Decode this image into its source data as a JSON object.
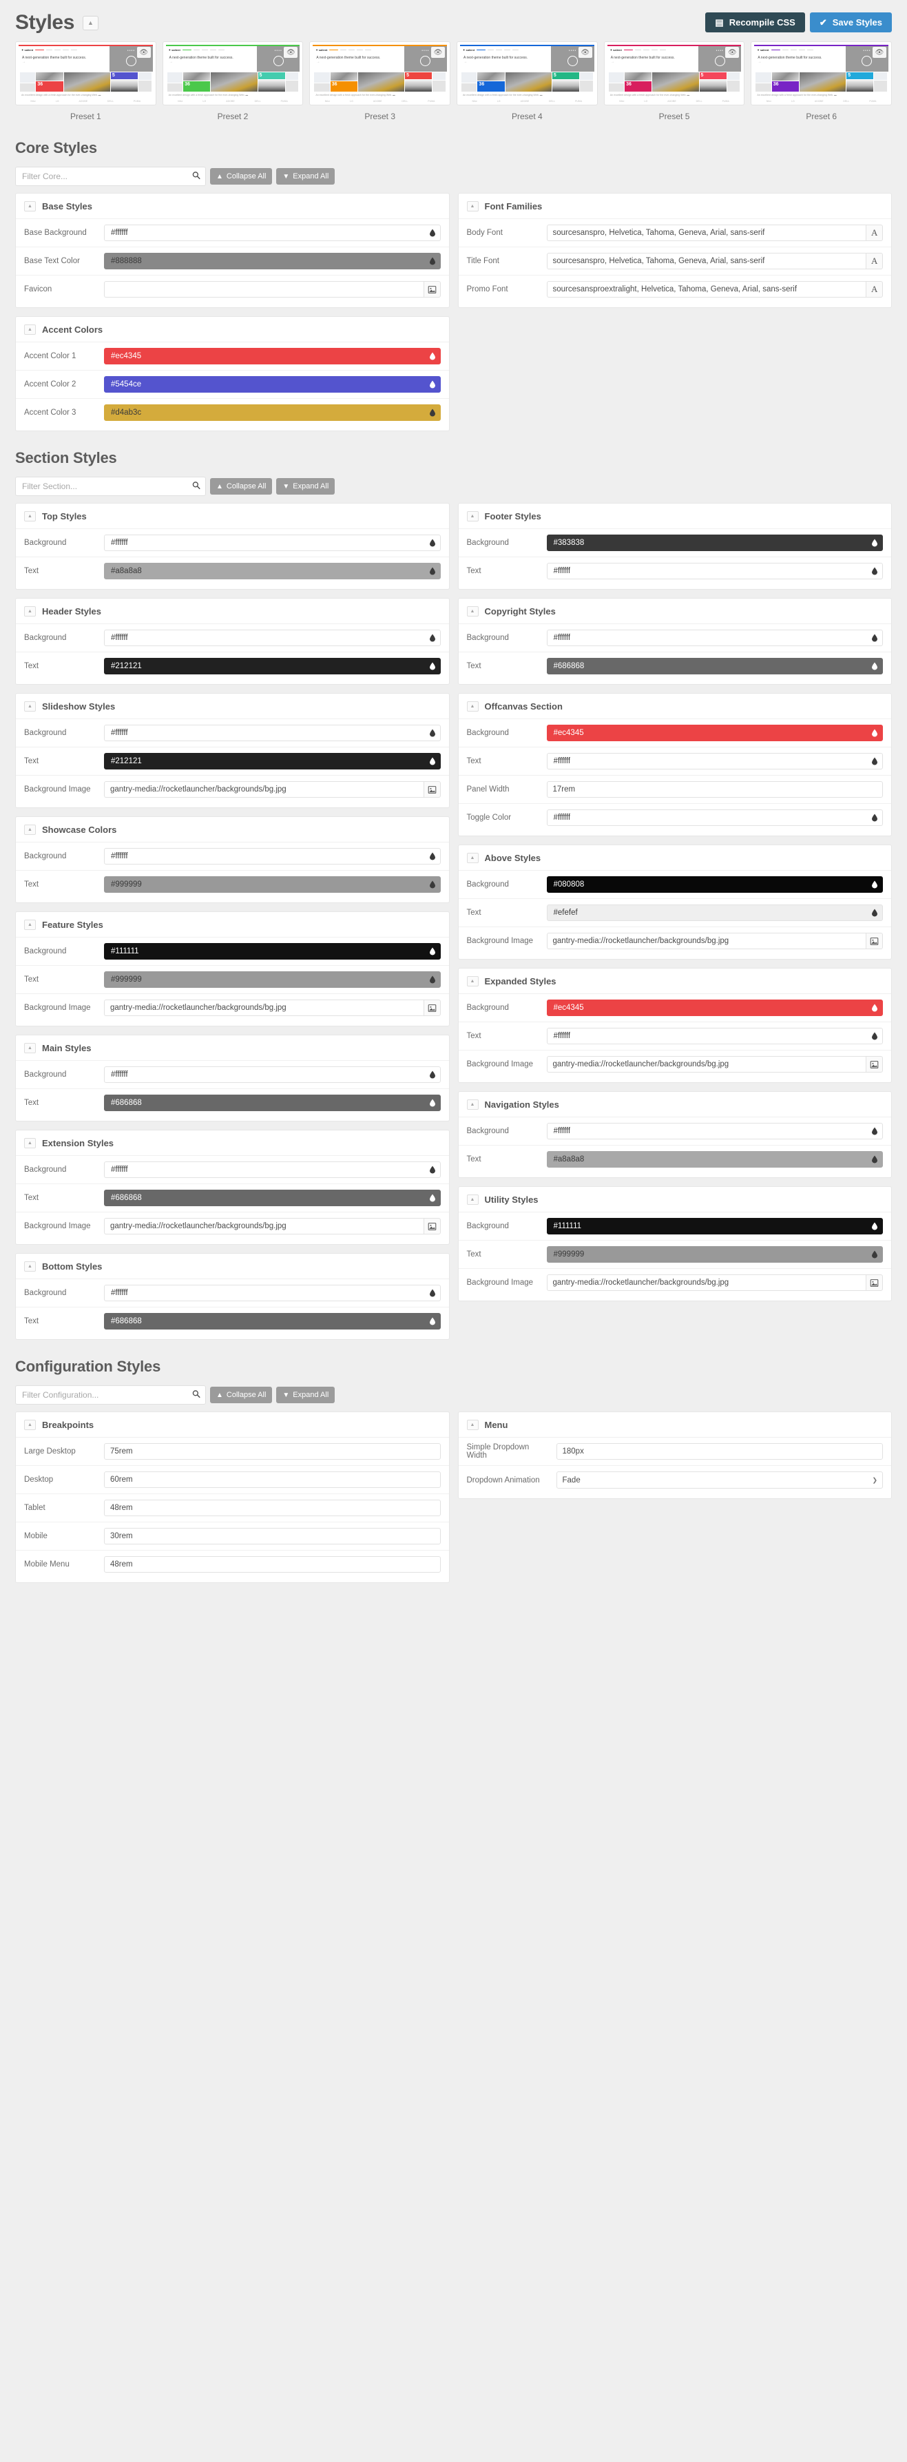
{
  "header": {
    "title": "Styles",
    "collapse_caret": "▲",
    "recompile_label": "Recompile CSS",
    "save_label": "Save Styles"
  },
  "presets": {
    "logo_text": "salient",
    "hero_text": "A next-generation theme built for success.",
    "caption": "An excellent design with a fresh approach for the ever-changing Web.",
    "tile_number_big": "36",
    "tile_number_small": "5",
    "tile_big_sub": "PROJECTS",
    "tile_small_sub": "TEAM MEMBERS",
    "brands": [
      "Nike",
      "LG",
      "ADOBE",
      "DELL",
      "PUMA"
    ],
    "items": [
      {
        "label": "Preset 1",
        "accent1": "#ec4345",
        "accent2": "#5454ce",
        "accent3": "#060606",
        "topline": "#ec4345"
      },
      {
        "label": "Preset 2",
        "accent1": "#4bc84b",
        "accent2": "#44ccae",
        "accent3": "#060606",
        "topline": "#4bc84b"
      },
      {
        "label": "Preset 3",
        "accent1": "#f59000",
        "accent2": "#ee4540",
        "accent3": "#060606",
        "topline": "#f59000"
      },
      {
        "label": "Preset 4",
        "accent1": "#1567d8",
        "accent2": "#24b785",
        "accent3": "#060606",
        "topline": "#1567d8"
      },
      {
        "label": "Preset 5",
        "accent1": "#d81f5e",
        "accent2": "#f4465a",
        "accent3": "#060606",
        "topline": "#d81f5e"
      },
      {
        "label": "Preset 6",
        "accent1": "#7824c5",
        "accent2": "#21a9db",
        "accent3": "#060606",
        "topline": "#7824c5"
      }
    ]
  },
  "core": {
    "title": "Core Styles",
    "filter_placeholder": "Filter Core...",
    "collapse_all": "Collapse All",
    "expand_all": "Expand All",
    "panels_left": [
      {
        "name": "Base Styles",
        "fields": [
          {
            "label": "Base Background",
            "type": "color",
            "value": "#ffffff",
            "bg": "#ffffff",
            "fg": "#3a3a3a"
          },
          {
            "label": "Base Text Color",
            "type": "color",
            "value": "#888888",
            "bg": "#888888",
            "fg": "#3a3a3a"
          },
          {
            "label": "Favicon",
            "type": "file",
            "value": "",
            "placeholder": ""
          }
        ]
      },
      {
        "name": "Accent Colors",
        "fields": [
          {
            "label": "Accent Color 1",
            "type": "color",
            "value": "#ec4345",
            "bg": "#ec4345",
            "fg": "#ffffff"
          },
          {
            "label": "Accent Color 2",
            "type": "color",
            "value": "#5454ce",
            "bg": "#5454ce",
            "fg": "#ffffff"
          },
          {
            "label": "Accent Color 3",
            "type": "color",
            "value": "#d4ab3c",
            "bg": "#d4ab3c",
            "fg": "#3a3a3a"
          }
        ]
      }
    ],
    "panels_right": [
      {
        "name": "Font Families",
        "fields": [
          {
            "label": "Body Font",
            "type": "font",
            "value": "sourcesanspro, Helvetica, Tahoma, Geneva, Arial, sans-serif"
          },
          {
            "label": "Title Font",
            "type": "font",
            "value": "sourcesanspro, Helvetica, Tahoma, Geneva, Arial, sans-serif"
          },
          {
            "label": "Promo Font",
            "type": "font",
            "value": "sourcesansproextralight, Helvetica, Tahoma, Geneva, Arial, sans-serif"
          }
        ]
      }
    ]
  },
  "section": {
    "title": "Section Styles",
    "filter_placeholder": "Filter Section...",
    "collapse_all": "Collapse All",
    "expand_all": "Expand All",
    "panels_left": [
      {
        "name": "Top Styles",
        "fields": [
          {
            "label": "Background",
            "type": "color",
            "value": "#ffffff",
            "bg": "#ffffff",
            "fg": "#3a3a3a"
          },
          {
            "label": "Text",
            "type": "color",
            "value": "#a8a8a8",
            "bg": "#a8a8a8",
            "fg": "#3a3a3a"
          }
        ]
      },
      {
        "name": "Header Styles",
        "fields": [
          {
            "label": "Background",
            "type": "color",
            "value": "#ffffff",
            "bg": "#ffffff",
            "fg": "#3a3a3a"
          },
          {
            "label": "Text",
            "type": "color",
            "value": "#212121",
            "bg": "#212121",
            "fg": "#ffffff"
          }
        ]
      },
      {
        "name": "Slideshow Styles",
        "fields": [
          {
            "label": "Background",
            "type": "color",
            "value": "#ffffff",
            "bg": "#ffffff",
            "fg": "#3a3a3a"
          },
          {
            "label": "Text",
            "type": "color",
            "value": "#212121",
            "bg": "#212121",
            "fg": "#ffffff"
          },
          {
            "label": "Background Image",
            "type": "file",
            "value": "gantry-media://rocketlauncher/backgrounds/bg.jpg"
          }
        ]
      },
      {
        "name": "Showcase Colors",
        "fields": [
          {
            "label": "Background",
            "type": "color",
            "value": "#ffffff",
            "bg": "#ffffff",
            "fg": "#3a3a3a"
          },
          {
            "label": "Text",
            "type": "color",
            "value": "#999999",
            "bg": "#999999",
            "fg": "#3a3a3a"
          }
        ]
      },
      {
        "name": "Feature Styles",
        "fields": [
          {
            "label": "Background",
            "type": "color",
            "value": "#111111",
            "bg": "#111111",
            "fg": "#ffffff"
          },
          {
            "label": "Text",
            "type": "color",
            "value": "#999999",
            "bg": "#999999",
            "fg": "#3a3a3a"
          },
          {
            "label": "Background Image",
            "type": "file",
            "value": "gantry-media://rocketlauncher/backgrounds/bg.jpg"
          }
        ]
      },
      {
        "name": "Main Styles",
        "fields": [
          {
            "label": "Background",
            "type": "color",
            "value": "#ffffff",
            "bg": "#ffffff",
            "fg": "#3a3a3a"
          },
          {
            "label": "Text",
            "type": "color",
            "value": "#686868",
            "bg": "#686868",
            "fg": "#ffffff"
          }
        ]
      },
      {
        "name": "Extension Styles",
        "fields": [
          {
            "label": "Background",
            "type": "color",
            "value": "#ffffff",
            "bg": "#ffffff",
            "fg": "#3a3a3a"
          },
          {
            "label": "Text",
            "type": "color",
            "value": "#686868",
            "bg": "#686868",
            "fg": "#ffffff"
          },
          {
            "label": "Background Image",
            "type": "file",
            "value": "gantry-media://rocketlauncher/backgrounds/bg.jpg"
          }
        ]
      },
      {
        "name": "Bottom Styles",
        "fields": [
          {
            "label": "Background",
            "type": "color",
            "value": "#ffffff",
            "bg": "#ffffff",
            "fg": "#3a3a3a"
          },
          {
            "label": "Text",
            "type": "color",
            "value": "#686868",
            "bg": "#686868",
            "fg": "#ffffff"
          }
        ]
      }
    ],
    "panels_right": [
      {
        "name": "Footer Styles",
        "fields": [
          {
            "label": "Background",
            "type": "color",
            "value": "#383838",
            "bg": "#383838",
            "fg": "#ffffff"
          },
          {
            "label": "Text",
            "type": "color",
            "value": "#ffffff",
            "bg": "#ffffff",
            "fg": "#3a3a3a"
          }
        ]
      },
      {
        "name": "Copyright Styles",
        "fields": [
          {
            "label": "Background",
            "type": "color",
            "value": "#ffffff",
            "bg": "#ffffff",
            "fg": "#3a3a3a"
          },
          {
            "label": "Text",
            "type": "color",
            "value": "#686868",
            "bg": "#686868",
            "fg": "#ffffff"
          }
        ]
      },
      {
        "name": "Offcanvas Section",
        "fields": [
          {
            "label": "Background",
            "type": "color",
            "value": "#ec4345",
            "bg": "#ec4345",
            "fg": "#ffffff"
          },
          {
            "label": "Text",
            "type": "color",
            "value": "#ffffff",
            "bg": "#ffffff",
            "fg": "#3a3a3a"
          },
          {
            "label": "Panel Width",
            "type": "text",
            "value": "17rem"
          },
          {
            "label": "Toggle Color",
            "type": "color",
            "value": "#ffffff",
            "bg": "#ffffff",
            "fg": "#3a3a3a"
          }
        ]
      },
      {
        "name": "Above Styles",
        "fields": [
          {
            "label": "Background",
            "type": "color",
            "value": "#080808",
            "bg": "#080808",
            "fg": "#ffffff"
          },
          {
            "label": "Text",
            "type": "color",
            "value": "#efefef",
            "bg": "#efefef",
            "fg": "#3a3a3a"
          },
          {
            "label": "Background Image",
            "type": "file",
            "value": "gantry-media://rocketlauncher/backgrounds/bg.jpg"
          }
        ]
      },
      {
        "name": "Expanded Styles",
        "fields": [
          {
            "label": "Background",
            "type": "color",
            "value": "#ec4345",
            "bg": "#ec4345",
            "fg": "#ffffff"
          },
          {
            "label": "Text",
            "type": "color",
            "value": "#ffffff",
            "bg": "#ffffff",
            "fg": "#3a3a3a"
          },
          {
            "label": "Background Image",
            "type": "file",
            "value": "gantry-media://rocketlauncher/backgrounds/bg.jpg"
          }
        ]
      },
      {
        "name": "Navigation Styles",
        "fields": [
          {
            "label": "Background",
            "type": "color",
            "value": "#ffffff",
            "bg": "#ffffff",
            "fg": "#3a3a3a"
          },
          {
            "label": "Text",
            "type": "color",
            "value": "#a8a8a8",
            "bg": "#a8a8a8",
            "fg": "#3a3a3a"
          }
        ]
      },
      {
        "name": "Utility Styles",
        "fields": [
          {
            "label": "Background",
            "type": "color",
            "value": "#111111",
            "bg": "#111111",
            "fg": "#ffffff"
          },
          {
            "label": "Text",
            "type": "color",
            "value": "#999999",
            "bg": "#999999",
            "fg": "#3a3a3a"
          },
          {
            "label": "Background Image",
            "type": "file",
            "value": "gantry-media://rocketlauncher/backgrounds/bg.jpg"
          }
        ]
      }
    ]
  },
  "configuration": {
    "title": "Configuration Styles",
    "filter_placeholder": "Filter Configuration...",
    "collapse_all": "Collapse All",
    "expand_all": "Expand All",
    "panels_left": [
      {
        "name": "Breakpoints",
        "fields": [
          {
            "label": "Large Desktop",
            "type": "text",
            "value": "75rem"
          },
          {
            "label": "Desktop",
            "type": "text",
            "value": "60rem"
          },
          {
            "label": "Tablet",
            "type": "text",
            "value": "48rem"
          },
          {
            "label": "Mobile",
            "type": "text",
            "value": "30rem"
          },
          {
            "label": "Mobile Menu",
            "type": "text",
            "value": "48rem"
          }
        ]
      }
    ],
    "panels_right": [
      {
        "name": "Menu",
        "fields": [
          {
            "label": "Simple Dropdown Width",
            "type": "text",
            "value": "180px"
          },
          {
            "label": "Dropdown Animation",
            "type": "select",
            "value": "Fade"
          }
        ]
      }
    ]
  },
  "icons": {
    "search": "⌕",
    "collapse": "△",
    "expand": "▽",
    "eye": "◉",
    "image": "Ὓc",
    "font": "A",
    "check": "✔",
    "recompile": "☷",
    "caret_down": "∨"
  }
}
